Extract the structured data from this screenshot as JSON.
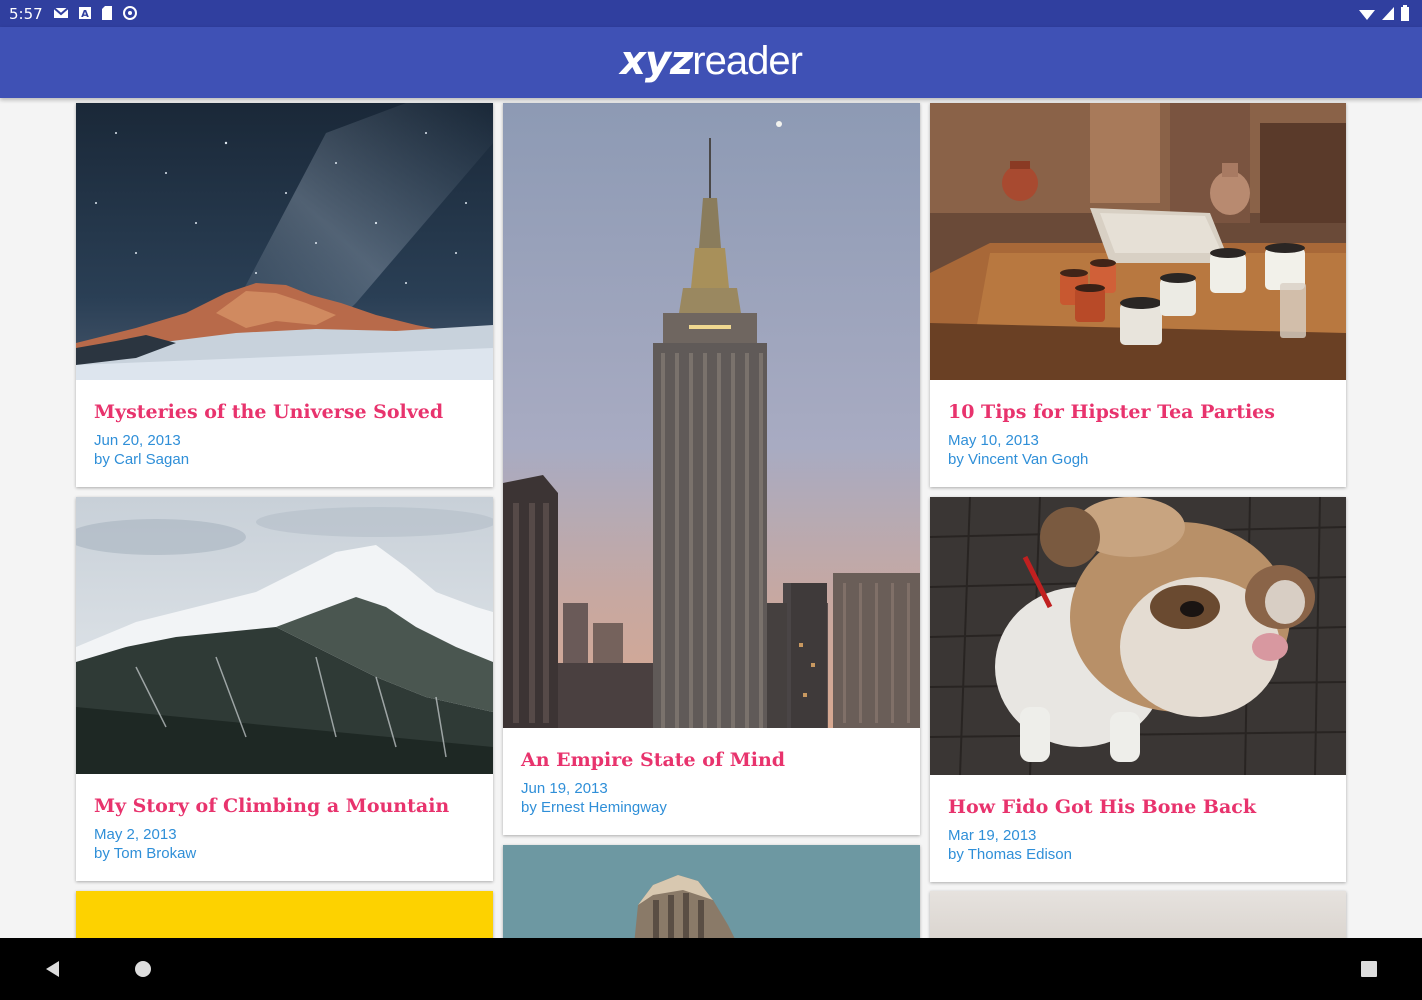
{
  "status_bar": {
    "time": "5:57",
    "left_icons": [
      "gmail-icon",
      "text-a-icon",
      "sd-card-icon",
      "sync-icon"
    ],
    "right_icons": [
      "wifi-icon",
      "signal-icon",
      "battery-icon"
    ]
  },
  "app_bar": {
    "logo_bold": "xyz",
    "logo_light": "reader"
  },
  "articles": [
    {
      "title": "Mysteries of the Universe Solved",
      "date": "Jun 20, 2013",
      "author": "by Carl Sagan",
      "image": "night-sky-mountain"
    },
    {
      "title": "An Empire State of Mind",
      "date": "Jun 19, 2013",
      "author": "by Ernest Hemingway",
      "image": "empire-state-building"
    },
    {
      "title": "10 Tips for Hipster Tea Parties",
      "date": "May 10, 2013",
      "author": "by Vincent Van Gogh",
      "image": "tea-cups-table"
    },
    {
      "title": "My Story of Climbing a Mountain",
      "date": "May 2, 2013",
      "author": "by Tom Brokaw",
      "image": "snowy-mountain"
    },
    {
      "title": "How Fido Got His Bone Back",
      "date": "Mar 19, 2013",
      "author": "by Thomas Edison",
      "image": "bulldog"
    }
  ],
  "partial_cards": [
    "yellow-image",
    "flatiron-building",
    "light-gray-image"
  ],
  "nav_bar": {
    "buttons": [
      "back-icon",
      "home-icon",
      "recents-icon"
    ]
  },
  "colors": {
    "primary": "#3f51b5",
    "primary_dark": "#303f9f",
    "title": "#e8336d",
    "meta": "#2f8fd8"
  }
}
